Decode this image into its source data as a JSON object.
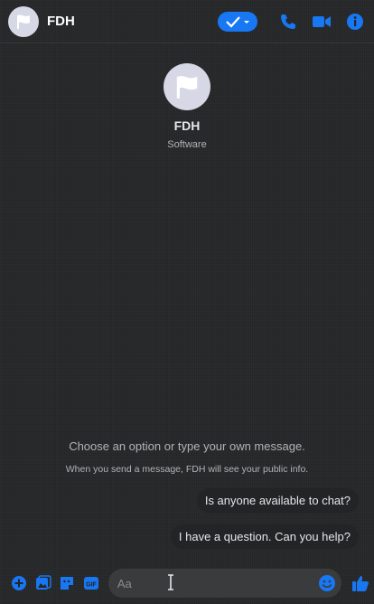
{
  "header": {
    "title": "FDH"
  },
  "profile": {
    "name": "FDH",
    "category": "Software"
  },
  "conversation": {
    "prompt": "Choose an option or type your own message.",
    "privacy_notice": "When you send a message, FDH will see your public info.",
    "quick_replies": [
      "Is anyone available to chat?",
      "I have a question. Can you help?"
    ]
  },
  "composer": {
    "placeholder": "Aa"
  },
  "colors": {
    "accent": "#1877f2",
    "background": "#242526",
    "text": "#e4e6eb"
  }
}
